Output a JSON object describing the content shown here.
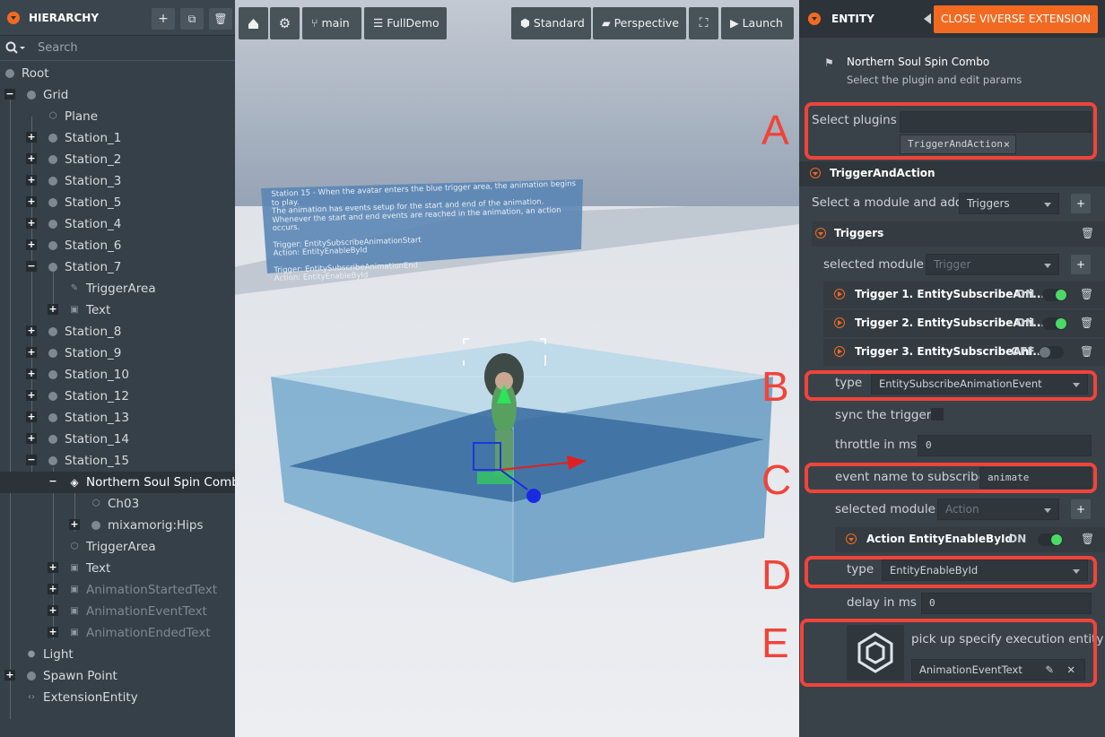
{
  "hierarchy": {
    "title": "HIERARCHY",
    "buttons": {
      "add": "+",
      "copy": "⧉",
      "delete": "🗑"
    },
    "search_placeholder": "Search",
    "items": [
      {
        "label": "Root"
      },
      {
        "label": "Grid"
      },
      {
        "label": "Plane"
      },
      {
        "label": "Station_1"
      },
      {
        "label": "Station_2"
      },
      {
        "label": "Station_3"
      },
      {
        "label": "Station_5"
      },
      {
        "label": "Station_4"
      },
      {
        "label": "Station_6"
      },
      {
        "label": "Station_7"
      },
      {
        "label": "TriggerArea"
      },
      {
        "label": "Text"
      },
      {
        "label": "Station_8"
      },
      {
        "label": "Station_9"
      },
      {
        "label": "Station_10"
      },
      {
        "label": "Station_12"
      },
      {
        "label": "Station_13"
      },
      {
        "label": "Station_14"
      },
      {
        "label": "Station_15"
      },
      {
        "label": "Northern Soul Spin Combo"
      },
      {
        "label": "Ch03"
      },
      {
        "label": "mixamorig:Hips"
      },
      {
        "label": "TriggerArea"
      },
      {
        "label": "Text"
      },
      {
        "label": "AnimationStartedText"
      },
      {
        "label": "AnimationEventText"
      },
      {
        "label": "AnimationEndedText"
      },
      {
        "label": "Light"
      },
      {
        "label": "Spawn Point"
      },
      {
        "label": "ExtensionEntity"
      }
    ]
  },
  "toolbar": {
    "branch": "main",
    "project": "FullDemo",
    "shading": "Standard",
    "camera": "Perspective",
    "launch": "Launch"
  },
  "scene": {
    "sign_lines": [
      "Station 15 - When the avatar enters the blue trigger area, the animation begins to play.",
      "The animation has events setup for the start and end of the animation.",
      "Whenever the start and end events are reached in the animation, an action occurs.",
      "",
      "Trigger: EntitySubscribeAnimationStart",
      "Action: EntityEnableById",
      "",
      "Trigger: EntitySubscribeAnimationEnd",
      "Action: EntityEnableById"
    ]
  },
  "entity": {
    "title": "ENTITY",
    "close_label": "CLOSE VIVERSE EXTENSION",
    "name": "Northern Soul Spin Combo",
    "subtitle": "Select the plugin and edit params",
    "select_plugins_label": "Select plugins",
    "plugin_tag": "TriggerAndAction",
    "section_title": "TriggerAndAction",
    "module_label": "Select a module and add",
    "module_value": "Triggers",
    "triggers_title": "Triggers",
    "selected_module_label": "selected module",
    "selected_module_value": "Trigger",
    "triggers": [
      {
        "title": "Trigger 1. EntitySubscribeAni...",
        "state": "ON",
        "on": true
      },
      {
        "title": "Trigger 2. EntitySubscribeAni...",
        "state": "ON",
        "on": true
      },
      {
        "title": "Trigger 3. EntitySubscribeAni...",
        "state": "OFF",
        "on": false
      }
    ],
    "type_label": "type",
    "type_value": "EntitySubscribeAnimationEvent",
    "sync_label": "sync the trigger",
    "throttle_label": "throttle in ms",
    "throttle_value": "0",
    "event_label": "event name to subscribe",
    "event_value": "animate",
    "action_module_label": "selected module",
    "action_module_value": "Action",
    "action_title": "Action EntityEnableById",
    "action_state": "ON",
    "action_type_label": "type",
    "action_type_value": "EntityEnableById",
    "delay_label": "delay in ms",
    "delay_value": "0",
    "pick_label": "pick up specify execution entity",
    "pick_value": "AnimationEventText"
  },
  "annotations": [
    "A",
    "B",
    "C",
    "D",
    "E"
  ],
  "colors": {
    "accent": "#f26a21",
    "highlight": "#f0443a",
    "toggle_on": "#4cd964"
  }
}
